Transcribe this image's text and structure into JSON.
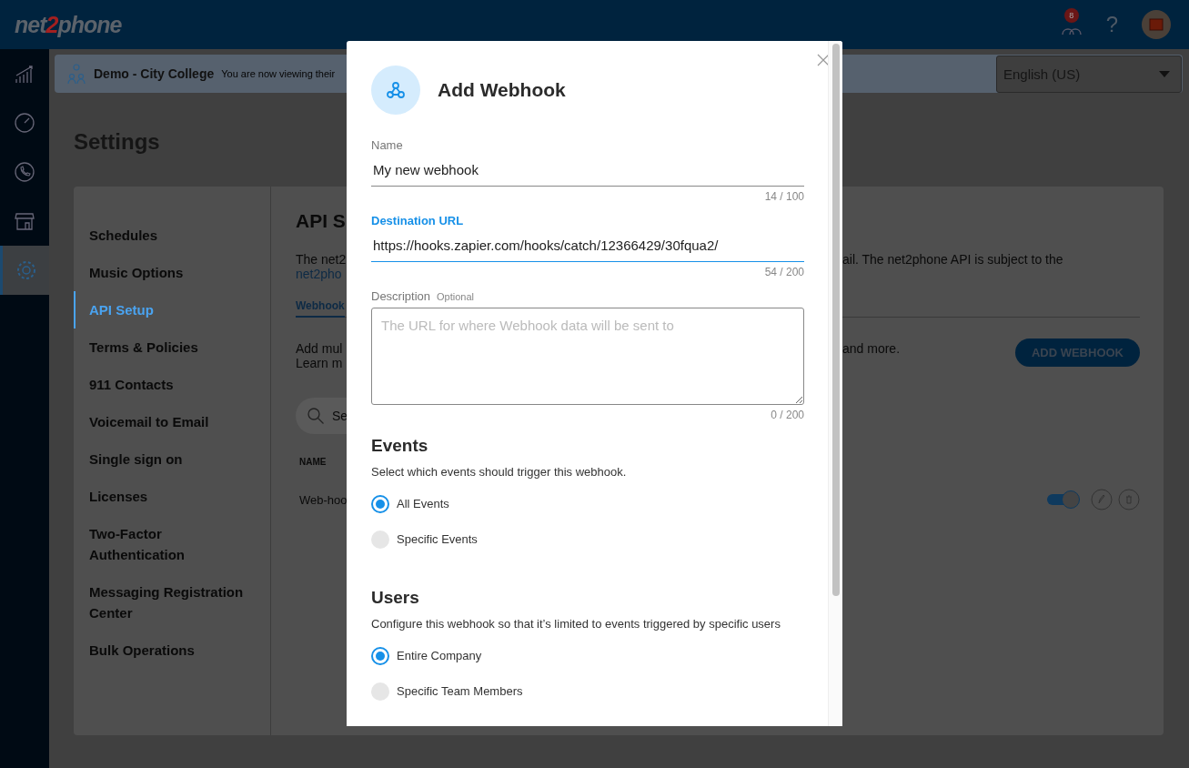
{
  "topbar": {
    "logo": [
      {
        "text": "net",
        "accent": false
      },
      {
        "text": "2",
        "accent": true
      },
      {
        "text": "phone",
        "accent": false
      }
    ],
    "notifications": "8",
    "help": "?"
  },
  "rail": [
    {
      "kind": "chart",
      "selected": false
    },
    {
      "kind": "gauge",
      "selected": false
    },
    {
      "kind": "phone",
      "selected": false
    },
    {
      "kind": "store",
      "selected": false
    },
    {
      "kind": "gear",
      "selected": true
    }
  ],
  "banner": {
    "account": "Demo - City College",
    "note": "You are now viewing their",
    "language": "English (US)"
  },
  "page_title": "Settings",
  "settings_nav": [
    {
      "label": "Schedules",
      "selected": false
    },
    {
      "label": "Music Options",
      "selected": false
    },
    {
      "label": "API Setup",
      "selected": true
    },
    {
      "label": "Terms & Policies",
      "selected": false
    },
    {
      "label": "911 Contacts",
      "selected": false
    },
    {
      "label": "Voicemail to Email",
      "selected": false
    },
    {
      "label": "Single sign on",
      "selected": false
    },
    {
      "label": "Licenses",
      "selected": false
    },
    {
      "label": "Two-Factor Authentication",
      "selected": false
    },
    {
      "label": "Messaging Registration Center",
      "selected": false
    },
    {
      "label": "Bulk Operations",
      "selected": false
    }
  ],
  "content": {
    "title": "API S",
    "intro_left": "The net2",
    "intro_right": "ail. The net2phone API is subject to the",
    "intro_link": "net2pho",
    "tab": "Webhook",
    "add_left_1": "Add mul",
    "add_right": "and more.",
    "add_left_2": "Learn m",
    "add_button": "ADD WEBHOOK",
    "search_placeholder": "Se",
    "column": "NAME",
    "row_name": "Web-hoo",
    "row_on": true
  },
  "modal": {
    "title": "Add Webhook",
    "fields": [
      {
        "kind": "text",
        "label": "Name",
        "value": "My new webhook",
        "counter": "14 / 100",
        "focused": false
      },
      {
        "kind": "text",
        "label": "Destination URL",
        "value": "https://hooks.zapier.com/hooks/catch/12366429/30fqua2/",
        "counter": "54 / 200",
        "focused": true
      },
      {
        "kind": "textarea",
        "label": "Description",
        "optional": "Optional",
        "placeholder": "The URL for where Webhook data will be sent to",
        "counter": "0 / 200",
        "focused": false
      }
    ],
    "groups": [
      {
        "heading": "Events",
        "text": "Select which events should trigger this webhook.",
        "options": [
          {
            "label": "All Events",
            "selected": true
          },
          {
            "label": "Specific Events",
            "selected": false
          }
        ]
      },
      {
        "heading": "Users",
        "text": "Configure this webhook so that it’s limited to events triggered by specific users",
        "options": [
          {
            "label": "Entire Company",
            "selected": true
          },
          {
            "label": "Specific Team Members",
            "selected": false
          }
        ]
      }
    ]
  }
}
